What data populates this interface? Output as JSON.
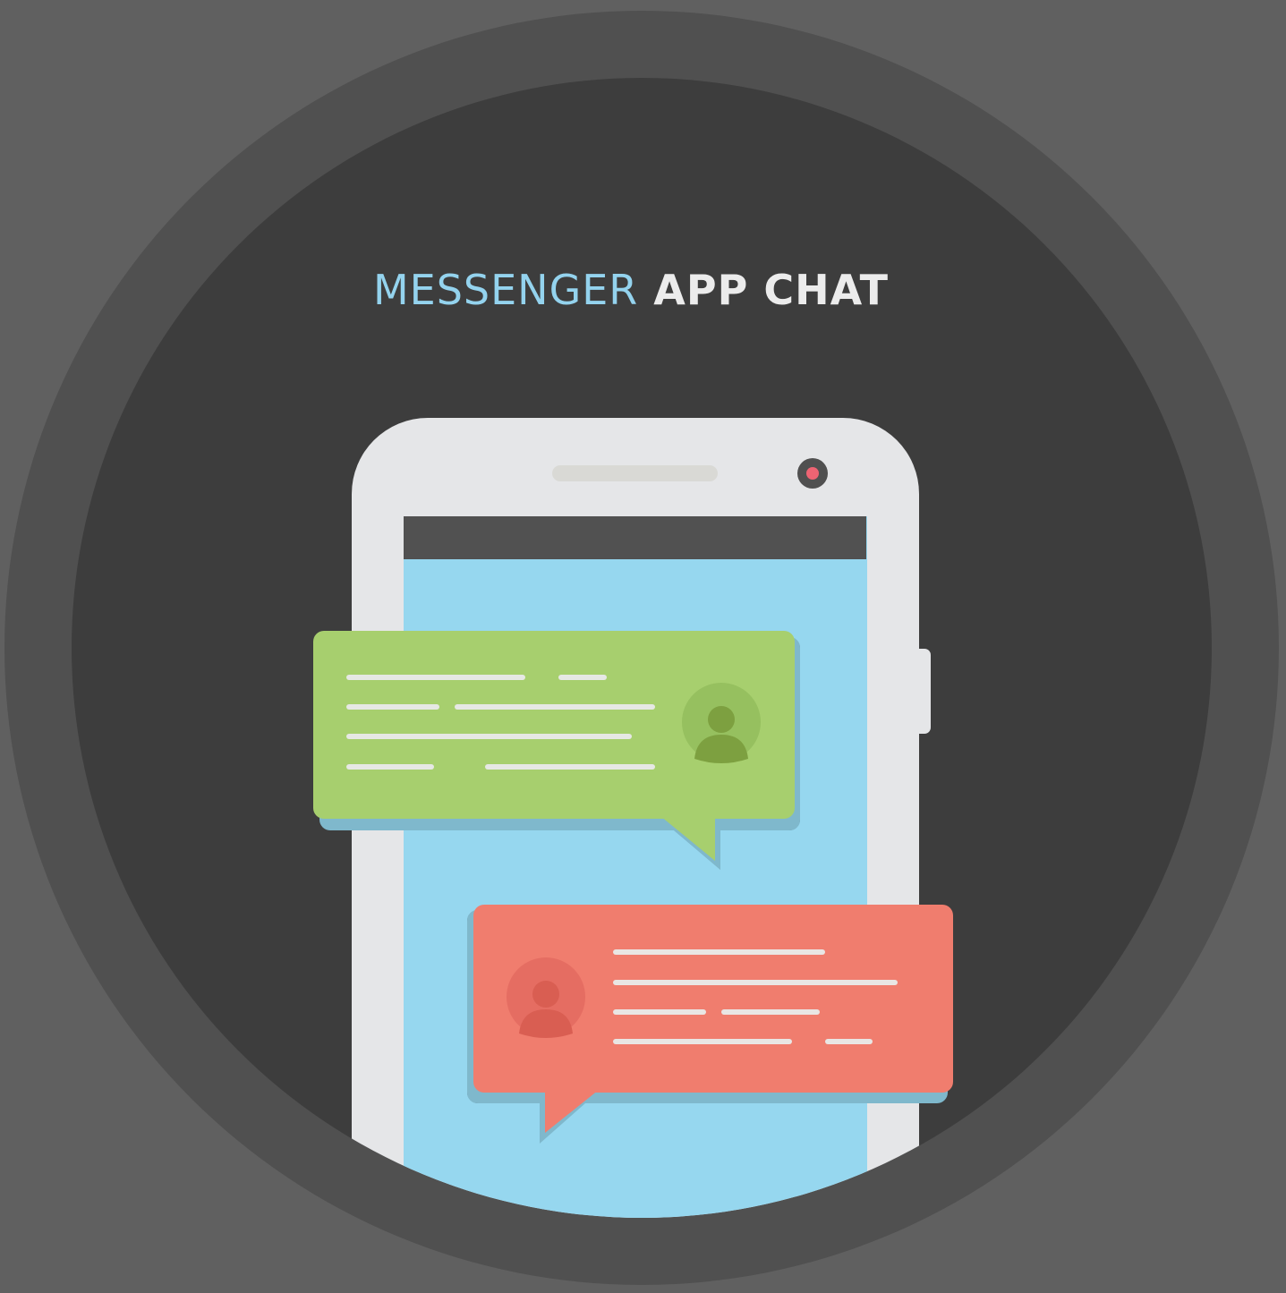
{
  "title": {
    "accent": "MESSENGER",
    "main": "APP CHAT"
  },
  "colors": {
    "background": "#606060",
    "outer_ring": "#505050",
    "inner_disc": "#3d3d3d",
    "title_accent": "#94d3ee",
    "title_main": "#ececec",
    "phone_body": "#e5e6e8",
    "phone_screen": "#96d7ef",
    "status_bar": "#515151",
    "camera_dot": "#ee6473",
    "incoming_bubble": "#a7cf6e",
    "incoming_avatar": "#7da040",
    "outgoing_bubble": "#f07d6e",
    "outgoing_avatar": "#d95e52"
  },
  "icons": {
    "incoming_avatar": "user-avatar-icon",
    "outgoing_avatar": "user-avatar-icon"
  }
}
